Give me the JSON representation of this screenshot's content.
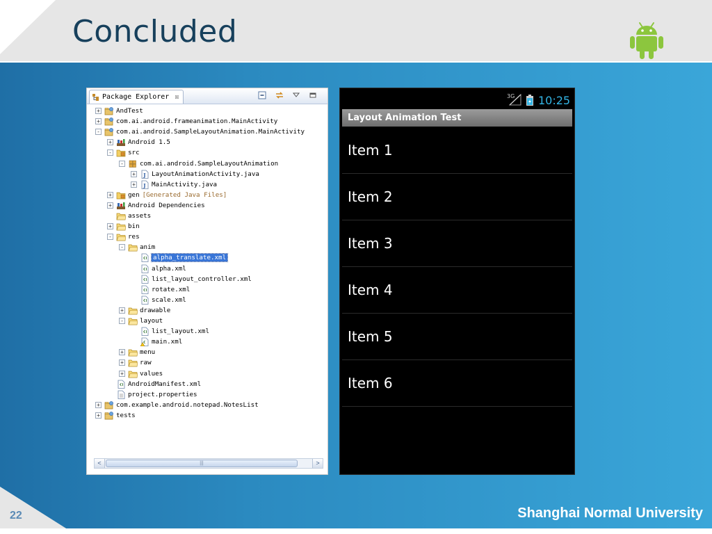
{
  "slide": {
    "title": "Concluded",
    "page_number": "22",
    "footer": "Shanghai Normal University",
    "colors": {
      "title": "#17405c",
      "band": "#2f8fc4",
      "footer_text": "#ffffff"
    },
    "logo": "android-robot-icon"
  },
  "package_explorer": {
    "tab_label": "Package Explorer",
    "tab_close": "☒",
    "tools": [
      "collapse-all-icon",
      "link-with-editor-icon",
      "view-menu-icon",
      "minimize-icon"
    ],
    "tree": [
      {
        "label": "AndTest",
        "depth": 0,
        "toggle": "+",
        "icon": "project-icon"
      },
      {
        "label": "com.ai.android.frameanimation.MainActivity",
        "depth": 0,
        "toggle": "+",
        "icon": "project-icon"
      },
      {
        "label": "com.ai.android.SampleLayoutAnimation.MainActivity",
        "depth": 0,
        "toggle": "-",
        "icon": "project-icon"
      },
      {
        "label": "Android 1.5",
        "depth": 1,
        "toggle": "+",
        "icon": "library-icon"
      },
      {
        "label": "src",
        "depth": 1,
        "toggle": "-",
        "icon": "source-folder-icon"
      },
      {
        "label": "com.ai.android.SampleLayoutAnimation",
        "depth": 2,
        "toggle": "-",
        "icon": "package-icon"
      },
      {
        "label": "LayoutAnimationActivity.java",
        "depth": 3,
        "toggle": "+",
        "icon": "java-file-icon"
      },
      {
        "label": "MainActivity.java",
        "depth": 3,
        "toggle": "+",
        "icon": "java-file-icon"
      },
      {
        "label": "gen",
        "depth": 1,
        "toggle": "+",
        "icon": "source-folder-icon",
        "decoration": "[Generated Java Files]"
      },
      {
        "label": "Android Dependencies",
        "depth": 1,
        "toggle": "+",
        "icon": "library-icon"
      },
      {
        "label": "assets",
        "depth": 1,
        "toggle": "",
        "icon": "folder-icon"
      },
      {
        "label": "bin",
        "depth": 1,
        "toggle": "+",
        "icon": "folder-icon"
      },
      {
        "label": "res",
        "depth": 1,
        "toggle": "-",
        "icon": "folder-icon"
      },
      {
        "label": "anim",
        "depth": 2,
        "toggle": "-",
        "icon": "folder-icon"
      },
      {
        "label": "alpha_translate.xml",
        "depth": 3,
        "toggle": "",
        "icon": "xml-file-icon",
        "selected": true
      },
      {
        "label": "alpha.xml",
        "depth": 3,
        "toggle": "",
        "icon": "xml-file-icon"
      },
      {
        "label": "list_layout_controller.xml",
        "depth": 3,
        "toggle": "",
        "icon": "xml-file-icon"
      },
      {
        "label": "rotate.xml",
        "depth": 3,
        "toggle": "",
        "icon": "xml-file-icon"
      },
      {
        "label": "scale.xml",
        "depth": 3,
        "toggle": "",
        "icon": "xml-file-icon"
      },
      {
        "label": "drawable",
        "depth": 2,
        "toggle": "+",
        "icon": "folder-icon"
      },
      {
        "label": "layout",
        "depth": 2,
        "toggle": "-",
        "icon": "folder-icon"
      },
      {
        "label": "list_layout.xml",
        "depth": 3,
        "toggle": "",
        "icon": "xml-file-icon"
      },
      {
        "label": "main.xml",
        "depth": 3,
        "toggle": "",
        "icon": "xml-file-warning-icon"
      },
      {
        "label": "menu",
        "depth": 2,
        "toggle": "+",
        "icon": "folder-icon"
      },
      {
        "label": "raw",
        "depth": 2,
        "toggle": "+",
        "icon": "folder-icon"
      },
      {
        "label": "values",
        "depth": 2,
        "toggle": "+",
        "icon": "folder-icon"
      },
      {
        "label": "AndroidManifest.xml",
        "depth": 1,
        "toggle": "",
        "icon": "xml-file-icon"
      },
      {
        "label": "project.properties",
        "depth": 1,
        "toggle": "",
        "icon": "text-file-icon"
      },
      {
        "label": "com.example.android.notepad.NotesList",
        "depth": 0,
        "toggle": "+",
        "icon": "project-icon"
      },
      {
        "label": "tests",
        "depth": 0,
        "toggle": "+",
        "icon": "project-icon"
      }
    ],
    "scrollbar": {
      "left": "<",
      "right": ">",
      "grip": "|||"
    }
  },
  "phone": {
    "status": {
      "network": "3G",
      "time": "10:25",
      "time_color": "#33b5e5"
    },
    "app_title": "Layout Animation Test",
    "items": [
      "Item 1",
      "Item 2",
      "Item 3",
      "Item 4",
      "Item 5",
      "Item 6"
    ]
  }
}
